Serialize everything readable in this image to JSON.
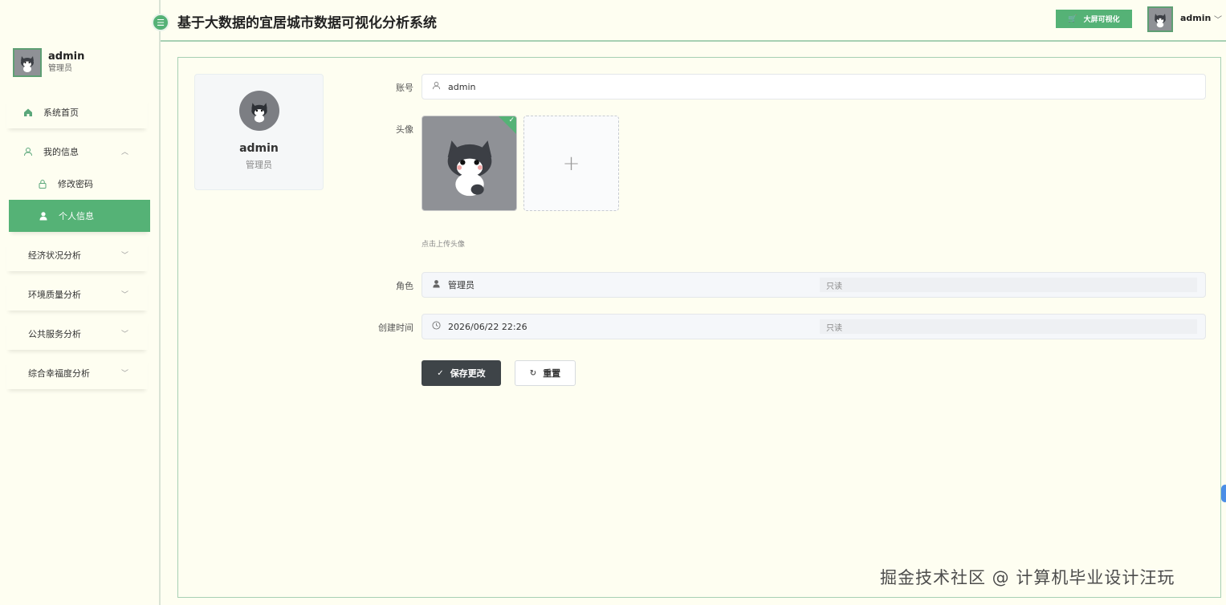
{
  "app": {
    "title": "基于大数据的宜居城市数据可视化分析系统"
  },
  "header": {
    "bigscreen_label": "大屏可视化",
    "username": "admin"
  },
  "sidebar": {
    "user": {
      "name": "admin",
      "role": "管理员"
    },
    "items": [
      {
        "label": "系统首页",
        "icon": "home-icon"
      },
      {
        "label": "我的信息",
        "icon": "user-outline-icon",
        "expanded": true
      },
      {
        "label": "修改密码",
        "icon": "lock-icon"
      },
      {
        "label": "个人信息",
        "icon": "user-filled-icon",
        "active": true
      },
      {
        "label": "经济状况分析"
      },
      {
        "label": "环境质量分析"
      },
      {
        "label": "公共服务分析"
      },
      {
        "label": "综合幸福度分析"
      }
    ]
  },
  "profile_card": {
    "name": "admin",
    "role": "管理员"
  },
  "form": {
    "account": {
      "label": "账号",
      "value": "admin"
    },
    "avatar": {
      "label": "头像",
      "hint": "点击上传头像",
      "add_symbol": "+"
    },
    "role": {
      "label": "角色",
      "value": "管理员",
      "readonly_tag": "只读"
    },
    "created": {
      "label": "创建时间",
      "value": "2026/06/22 22:26",
      "readonly_tag": "只读"
    }
  },
  "buttons": {
    "save": "保存更改",
    "reset": "重置"
  },
  "watermark": "掘金技术社区 @ 计算机毕业设计汪玩",
  "colors": {
    "accent": "#55b276",
    "dark_button": "#3e4448",
    "background": "#fefef1"
  }
}
